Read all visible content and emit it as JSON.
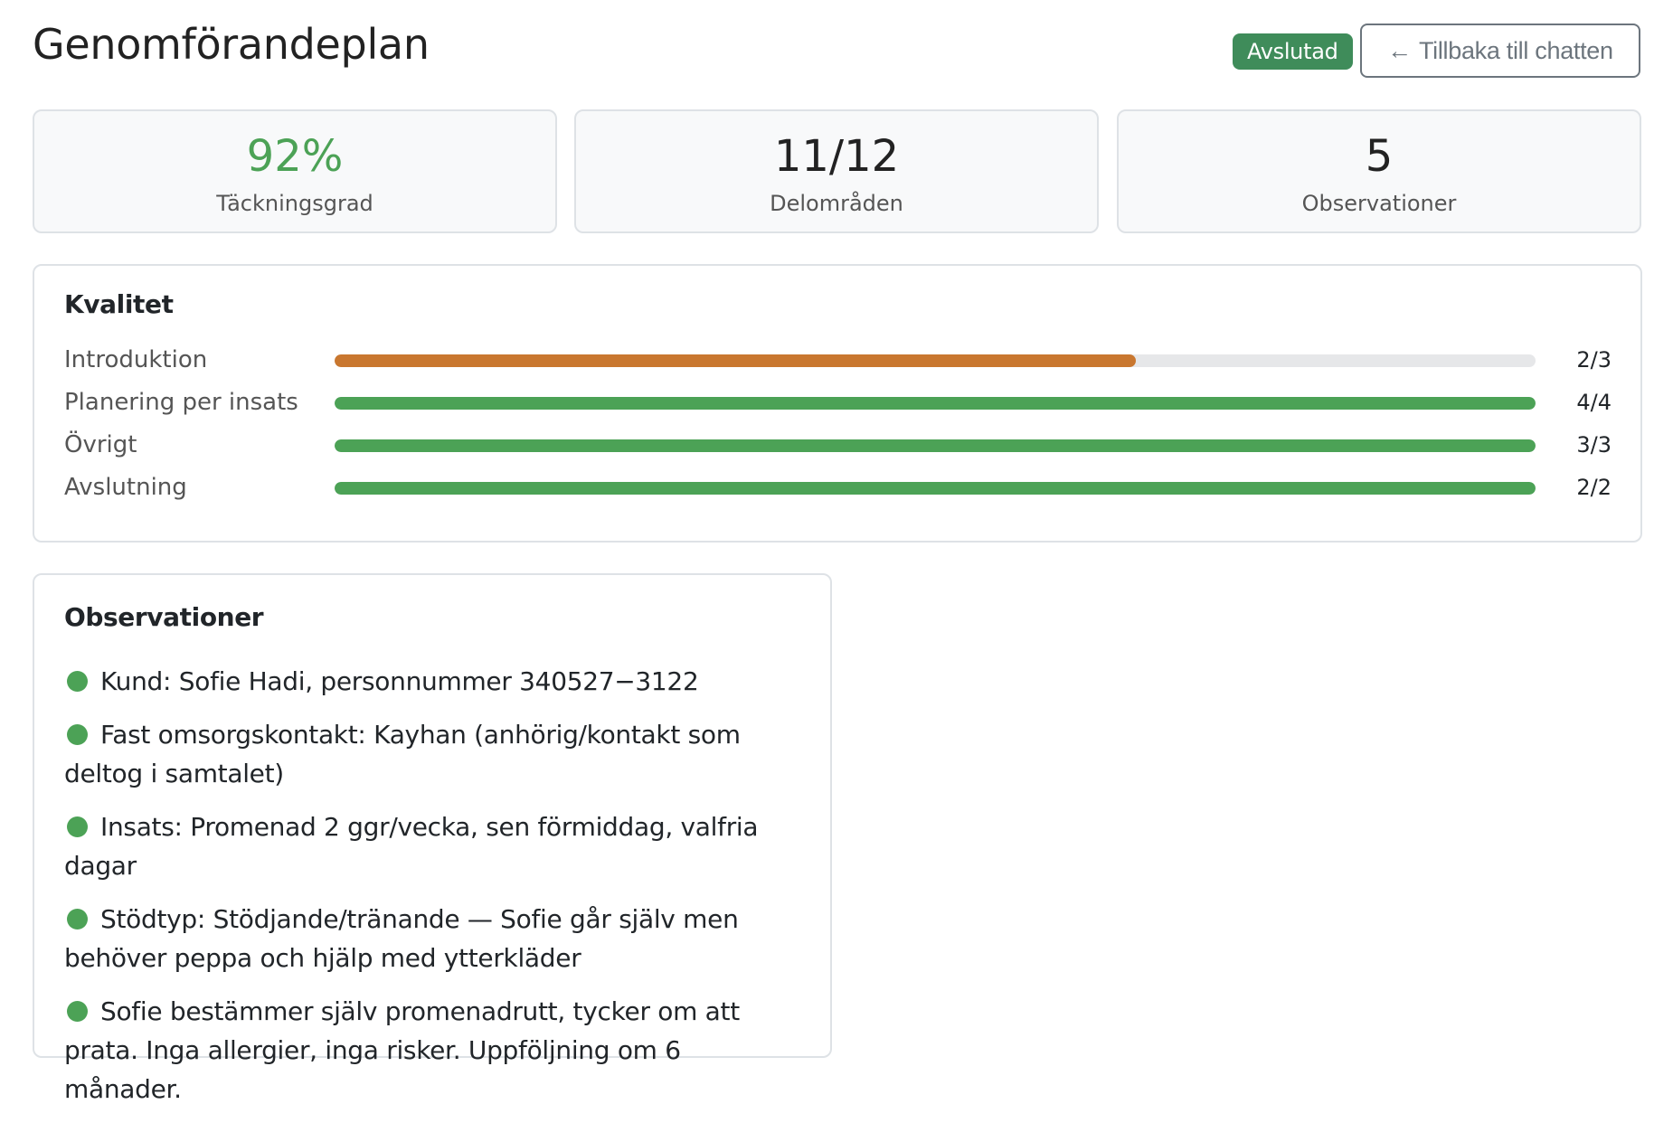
{
  "header": {
    "title": "Genomförandeplan",
    "status_badge": "Avslutad",
    "back_button": {
      "arrow": "←",
      "label": "Tillbaka till chatten"
    }
  },
  "stats": [
    {
      "value": "92%",
      "label": "Täckningsgrad"
    },
    {
      "value": "11/12",
      "label": "Delområden"
    },
    {
      "value": "5",
      "label": "Observationer"
    }
  ],
  "colors": {
    "accent_green": "#4ca256",
    "accent_orange": "#c9772f",
    "badge_green": "#3f8c5a"
  },
  "quality": {
    "title": "Kvalitet",
    "rows": [
      {
        "label": "Introduktion",
        "score": "2/3",
        "fraction": 0.667,
        "color": "#c9772f"
      },
      {
        "label": "Planering per insats",
        "score": "4/4",
        "fraction": 1.0,
        "color": "#4ca256"
      },
      {
        "label": "Övrigt",
        "score": "3/3",
        "fraction": 1.0,
        "color": "#4ca256"
      },
      {
        "label": "Avslutning",
        "score": "2/2",
        "fraction": 1.0,
        "color": "#4ca256"
      }
    ]
  },
  "observations": {
    "title": "Observationer",
    "items": [
      "Kund: Sofie Hadi, personnummer 340527−3122",
      "Fast omsorgskontakt: Kayhan (anhörig/kontakt som deltog i samtalet)",
      "Insats: Promenad 2 ggr/vecka, sen förmiddag, valfria dagar",
      "Stödtyp: Stödjande/tränande — Sofie går själv men behöver peppa och hjälp med ytterkläder",
      "Sofie bestämmer själv promenadrutt, tycker om att prata. Inga allergier, inga risker. Uppföljning om 6 månader."
    ]
  }
}
